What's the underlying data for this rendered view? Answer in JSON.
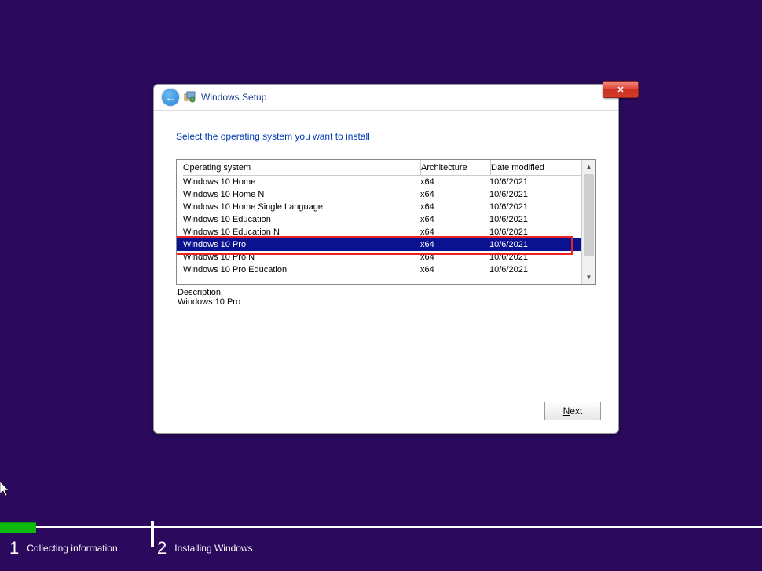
{
  "title": "Windows Setup",
  "heading": "Select the operating system you want to install",
  "columns": {
    "os": "Operating system",
    "arch": "Architecture",
    "date": "Date modified"
  },
  "rows": [
    {
      "os": "Windows 10 Home",
      "arch": "x64",
      "date": "10/6/2021"
    },
    {
      "os": "Windows 10 Home N",
      "arch": "x64",
      "date": "10/6/2021"
    },
    {
      "os": "Windows 10 Home Single Language",
      "arch": "x64",
      "date": "10/6/2021"
    },
    {
      "os": "Windows 10 Education",
      "arch": "x64",
      "date": "10/6/2021"
    },
    {
      "os": "Windows 10 Education N",
      "arch": "x64",
      "date": "10/6/2021"
    },
    {
      "os": "Windows 10 Pro",
      "arch": "x64",
      "date": "10/6/2021"
    },
    {
      "os": "Windows 10 Pro N",
      "arch": "x64",
      "date": "10/6/2021"
    },
    {
      "os": "Windows 10 Pro Education",
      "arch": "x64",
      "date": "10/6/2021"
    }
  ],
  "selectedIndex": 5,
  "highlightIndex": 5,
  "description": {
    "heading": "Description:",
    "value": "Windows 10 Pro"
  },
  "nextLabel": "Next",
  "steps": [
    {
      "num": "1",
      "label": "Collecting information"
    },
    {
      "num": "2",
      "label": "Installing Windows"
    }
  ]
}
